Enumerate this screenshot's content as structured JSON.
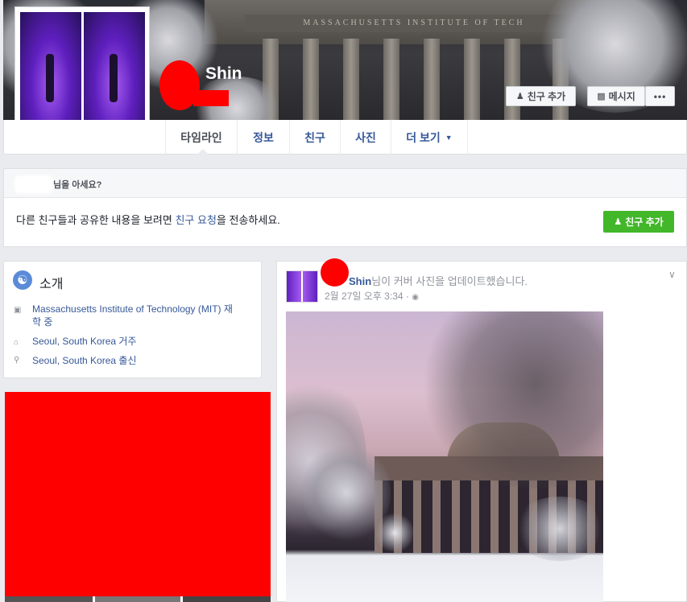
{
  "profile": {
    "name": "Shin"
  },
  "cover": {
    "frieze_text": "MASSACHUSETTS INSTITUTE OF TECH",
    "buttons": {
      "add_friend": "친구 추가",
      "message": "메시지",
      "more": "•••"
    }
  },
  "tabs": [
    {
      "label": "타임라인"
    },
    {
      "label": "정보"
    },
    {
      "label": "친구"
    },
    {
      "label": "사진"
    },
    {
      "label": "더 보기"
    }
  ],
  "suggest": {
    "header_suffix": "님을 아세요?",
    "body_prefix": "다른 친구들과 공유한 내용을 보려면 ",
    "body_link": "친구 요청",
    "body_suffix": "을 전송하세요.",
    "button": "친구 추가"
  },
  "intro": {
    "title": "소개",
    "items": [
      {
        "icon": "school-icon",
        "text": "Massachusetts Institute of Technology (MIT) 재",
        "text2": "학 중"
      },
      {
        "icon": "home-icon",
        "text": "Seoul, South Korea 거주"
      },
      {
        "icon": "location-pin-icon",
        "text": "Seoul, South Korea 출신"
      }
    ]
  },
  "post": {
    "author": "Shin",
    "action": "님이 커버 사진을 업데이트했습니다.",
    "time": "2월 27일 오후 3:34 ·"
  },
  "colors": {
    "link": "#365899",
    "green": "#42b72a",
    "redaction": "#ff0000"
  }
}
